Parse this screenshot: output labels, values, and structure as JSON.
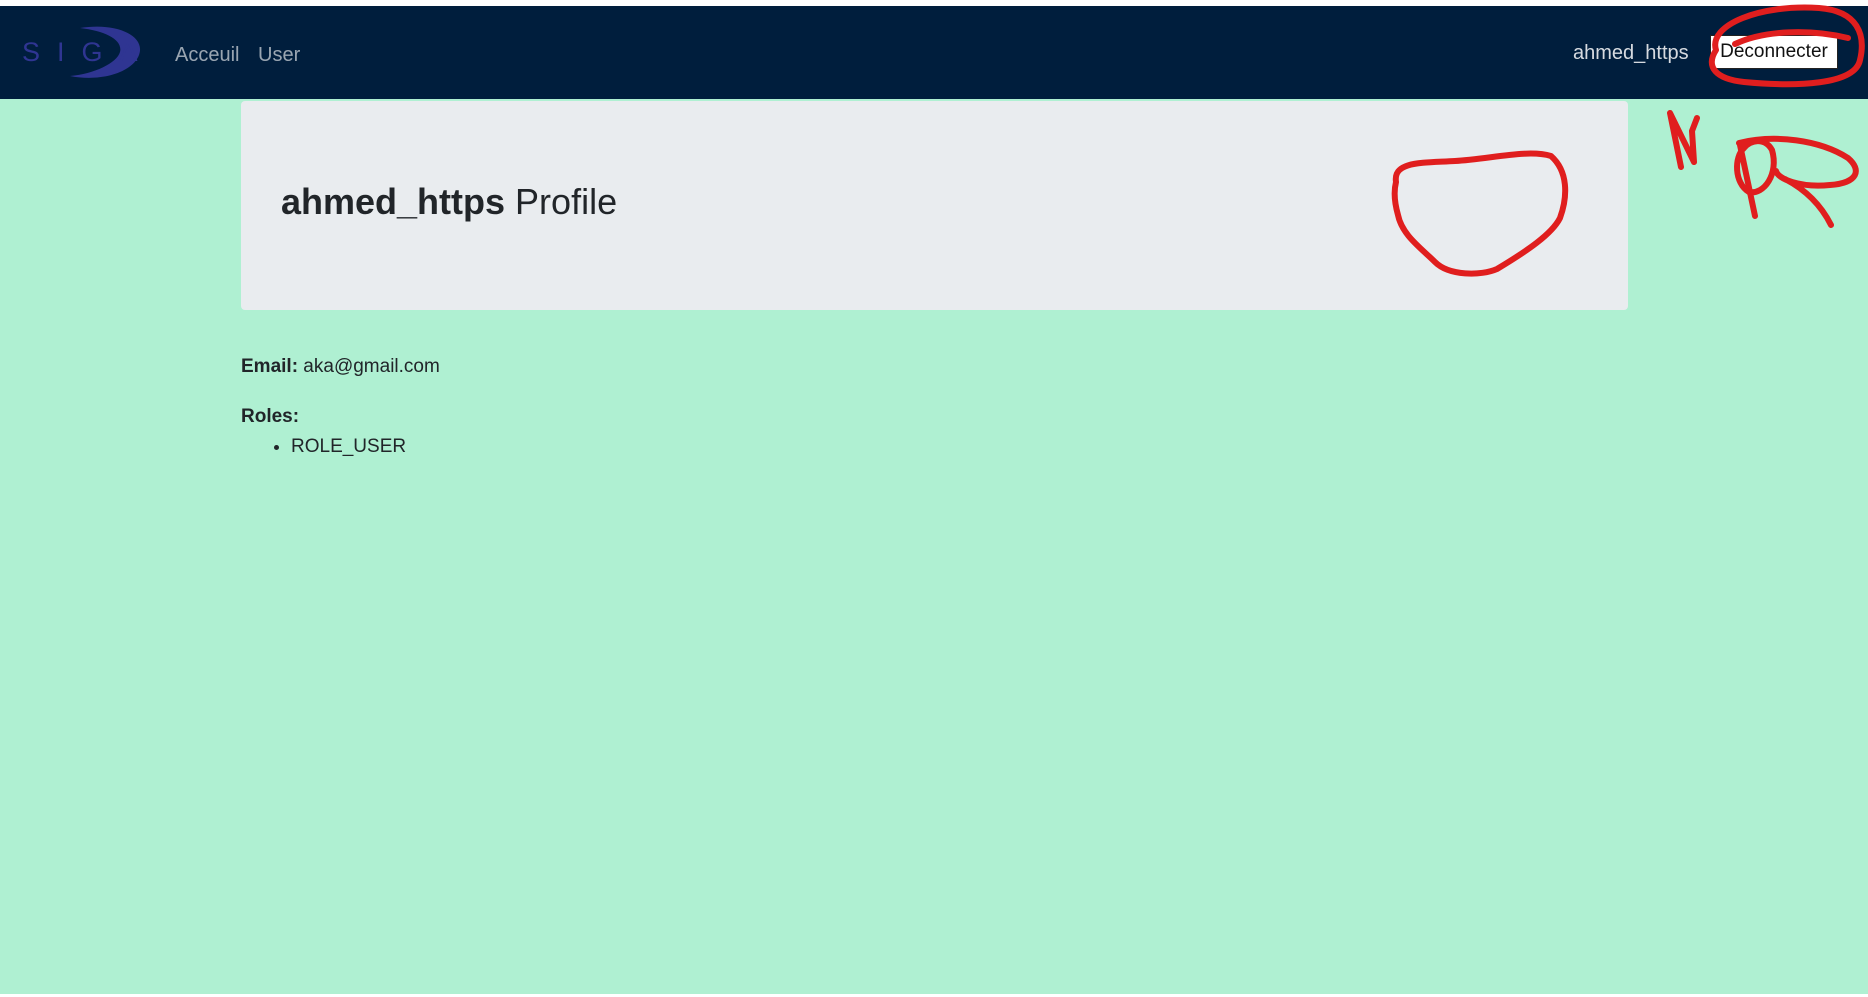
{
  "brand": {
    "logo_text": "SIGA",
    "logo_color": "#2f3592"
  },
  "navbar": {
    "links": [
      {
        "label": "Acceuil"
      },
      {
        "label": "User"
      }
    ],
    "username": "ahmed_https",
    "logout_label": "Déconnecter",
    "background": "#001e3d"
  },
  "profile": {
    "username": "ahmed_https",
    "title_suffix": " Profile",
    "email_label": "Email:",
    "email_value": " aka@gmail.com",
    "roles_label": "Roles:",
    "roles": [
      "ROLE_USER"
    ]
  },
  "annotations": {
    "color": "#e01e1e",
    "handwritten_text": "NOR",
    "marks": [
      "circle-around-logout-button",
      "circle-in-profile-header"
    ]
  },
  "colors": {
    "page_background": "#aff0d2",
    "jumbotron_background": "#e9ecef",
    "text": "#212529"
  }
}
